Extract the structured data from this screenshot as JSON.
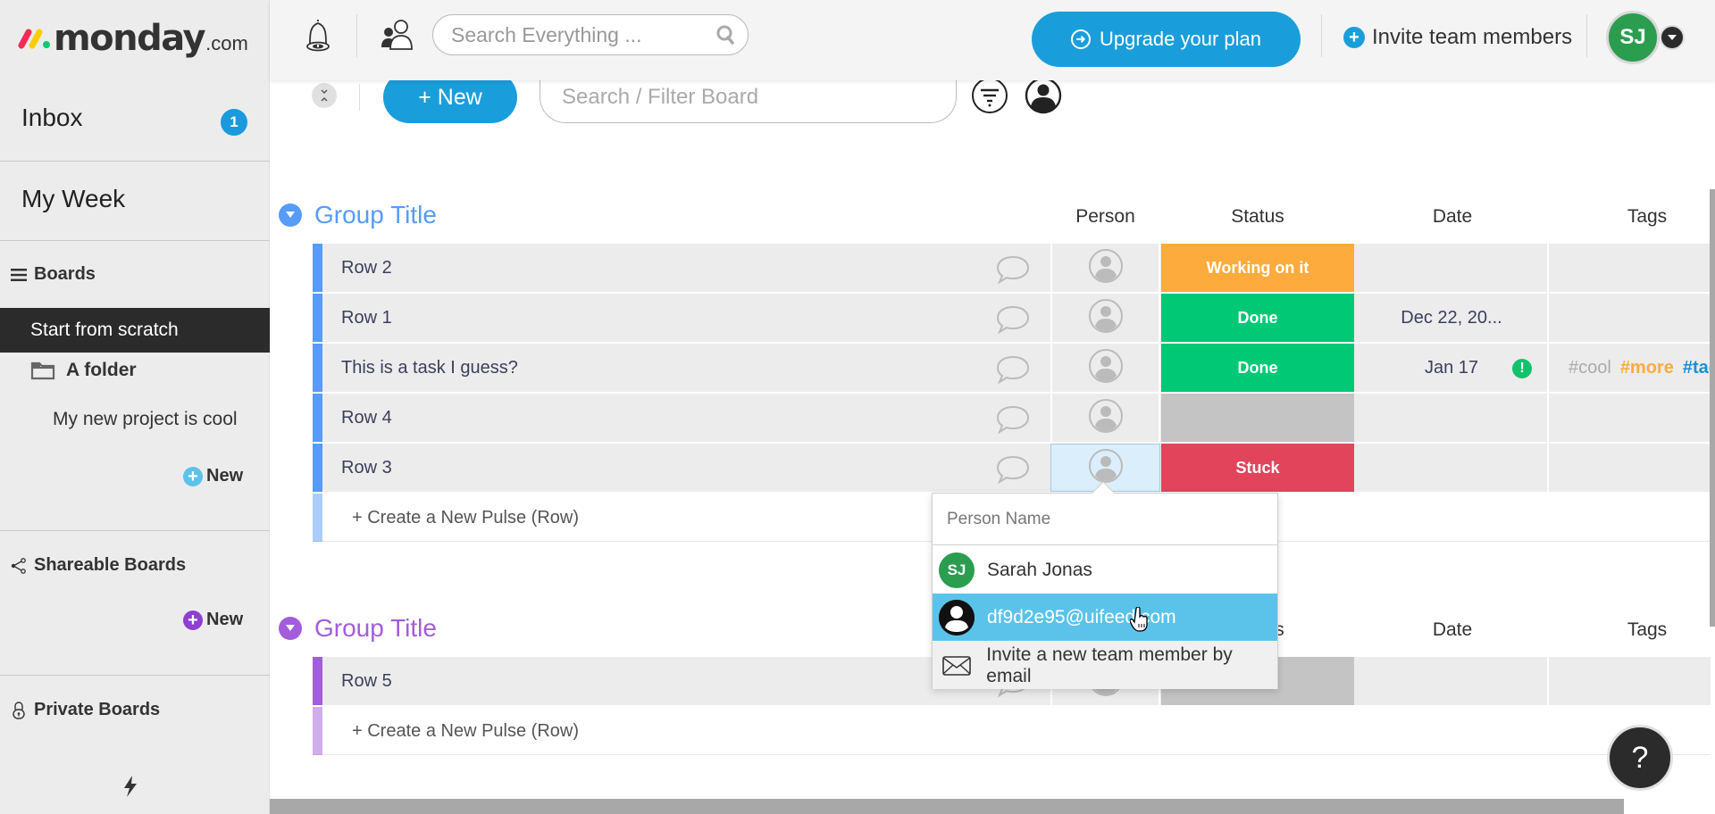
{
  "app": {
    "logo_word": "monday",
    "logo_suffix": ".com"
  },
  "sidebar": {
    "inbox_label": "Inbox",
    "inbox_count": "1",
    "my_week_label": "My Week",
    "boards_section": {
      "label": "Boards",
      "icon": "hamburger-icon"
    },
    "active_board": "Start from scratch",
    "folder": {
      "label": "A folder",
      "icon": "folder-icon"
    },
    "folder_board": "My new project is cool",
    "boards_new_label": "New",
    "shareable_section": {
      "label": "Shareable Boards",
      "icon": "share-icon"
    },
    "shareable_new_label": "New",
    "private_section": {
      "label": "Private Boards",
      "icon": "lock-icon"
    },
    "bottom_icon": "lightning-icon",
    "colors": {
      "boards_new": "#5bc3ea",
      "shareable_new": "#8e3fd1"
    }
  },
  "topbar": {
    "search_placeholder": "Search Everything ...",
    "upgrade_label": "Upgrade your plan",
    "invite_label": "Invite team members",
    "user_initials": "SJ"
  },
  "toolbar": {
    "new_label": "+ New",
    "filter_placeholder": "Search / Filter Board"
  },
  "columns": {
    "person": "Person",
    "status": "Status",
    "date": "Date",
    "tags": "Tags"
  },
  "groups": [
    {
      "title": "Group Title",
      "color": "#579bfc",
      "rows": [
        {
          "name": "Row 2",
          "status": "Working on it",
          "status_color": "#fdab3d",
          "date": "",
          "tags": []
        },
        {
          "name": "Row 1",
          "status": "Done",
          "status_color": "#00c875",
          "date": "Dec 22, 20...",
          "tags": []
        },
        {
          "name": "This is a task I guess?",
          "status": "Done",
          "status_color": "#00c875",
          "date": "Jan 17",
          "date_alert": true,
          "tags": [
            {
              "text": "#cool",
              "color": "#aaaaaa"
            },
            {
              "text": "#more",
              "color": "#fdab3d"
            },
            {
              "text": "#tags",
              "color": "#1a8fd6"
            }
          ]
        },
        {
          "name": "Row 4",
          "status": "",
          "status_color": "#c4c4c4",
          "date": "",
          "tags": []
        },
        {
          "name": "Row 3",
          "status": "Stuck",
          "status_color": "#e2445c",
          "date": "",
          "tags": [],
          "person_selected": true
        }
      ],
      "create_label": "+ Create a New Pulse (Row)"
    },
    {
      "title": "Group Title",
      "color": "#a25ddc",
      "rows": [
        {
          "name": "Row 5",
          "status": "",
          "status_color": "#c4c4c4",
          "date": "",
          "tags": []
        }
      ],
      "create_label": "+ Create a New Pulse (Row)"
    }
  ],
  "person_dropdown": {
    "placeholder": "Person Name",
    "options": [
      {
        "initials": "SJ",
        "label": "Sarah Jonas",
        "avatar_color": "#2a9d4f"
      },
      {
        "initials": "",
        "label": "df9d2e95@uifeed.com",
        "hovered": true
      },
      {
        "label": "Invite a new team member by email",
        "icon": "envelope-icon"
      }
    ]
  },
  "help_label": "?"
}
